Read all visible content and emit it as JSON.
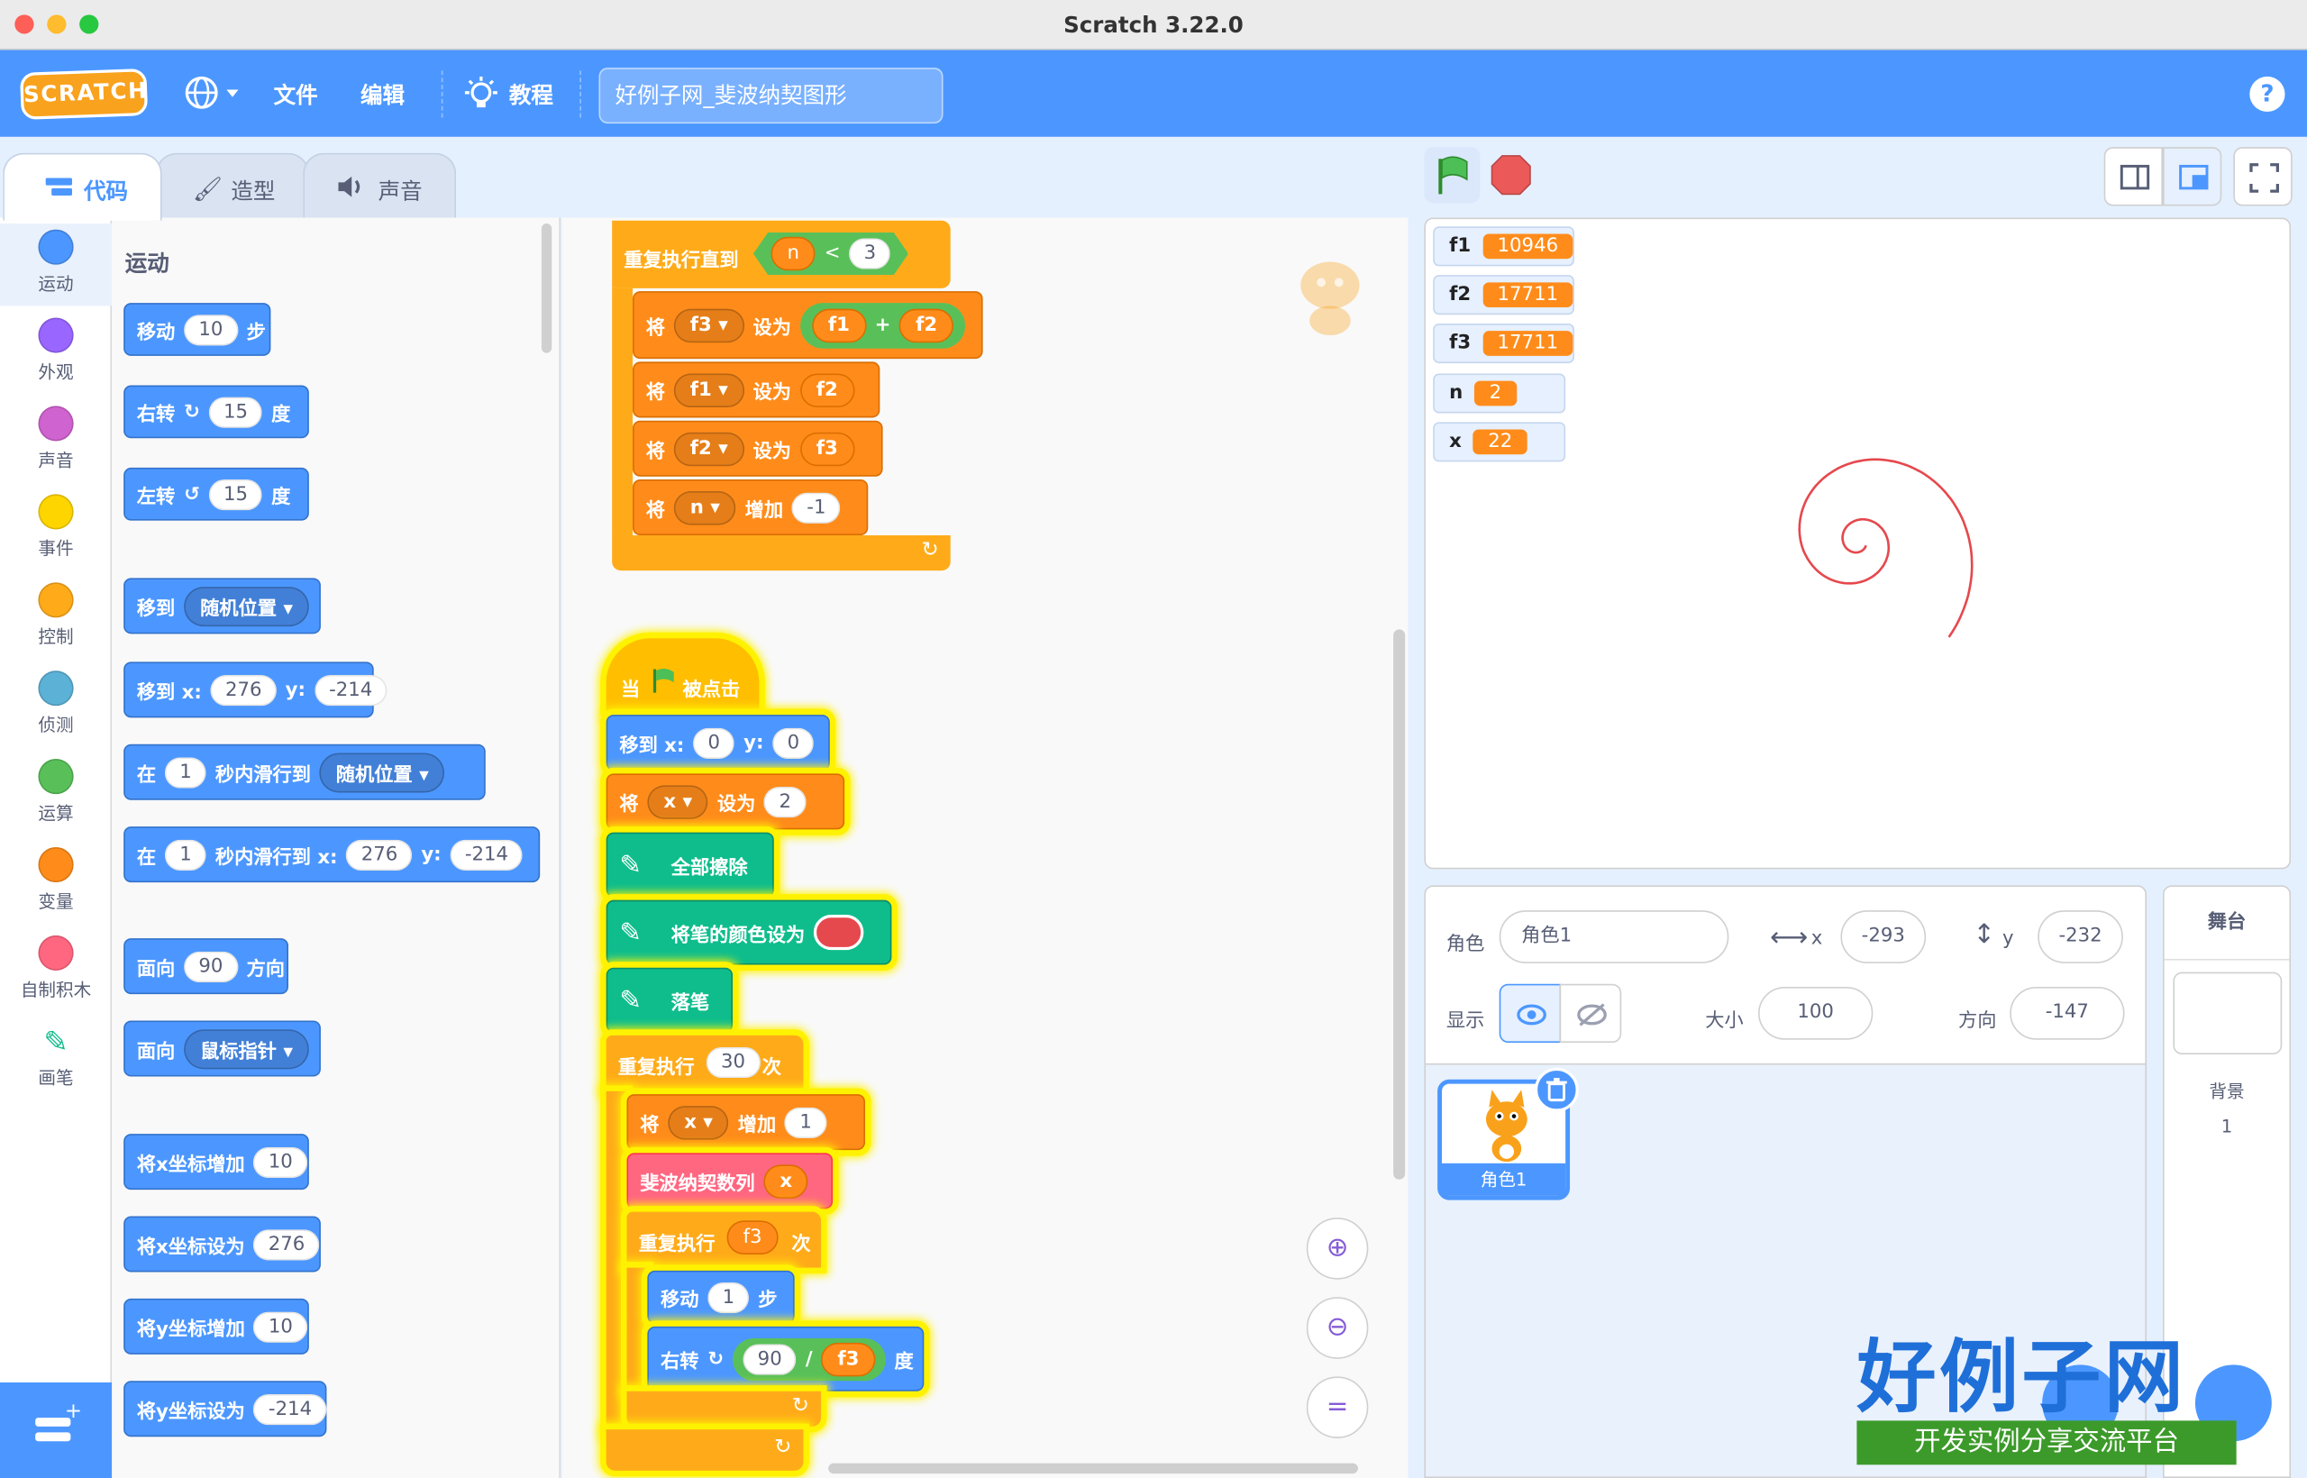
{
  "window": {
    "title": "Scratch 3.22.0"
  },
  "menubar": {
    "logo": "SCRATCH",
    "file": "文件",
    "edit": "编辑",
    "tutorials": "教程",
    "project_title": "好例子网_斐波纳契图形",
    "help": "?"
  },
  "tabs": {
    "code": "代码",
    "costumes": "造型",
    "sounds": "声音"
  },
  "categories": [
    {
      "label": "运动",
      "color": "#4c97ff"
    },
    {
      "label": "外观",
      "color": "#9966ff"
    },
    {
      "label": "声音",
      "color": "#cf63cf"
    },
    {
      "label": "事件",
      "color": "#ffd500"
    },
    {
      "label": "控制",
      "color": "#ffab19"
    },
    {
      "label": "侦测",
      "color": "#5cb1d6"
    },
    {
      "label": "运算",
      "color": "#59c059"
    },
    {
      "label": "变量",
      "color": "#ff8c1a"
    },
    {
      "label": "自制积木",
      "color": "#ff6680"
    },
    {
      "label": "画笔",
      "color": "#0fbd8c"
    }
  ],
  "palette": {
    "heading": "运动",
    "move": {
      "label": "移动",
      "steps": "10",
      "unit": "步"
    },
    "turn_right": {
      "label": "右转",
      "value": "15",
      "unit": "度"
    },
    "turn_left": {
      "label": "左转",
      "value": "15",
      "unit": "度"
    },
    "goto": {
      "label": "移到",
      "target": "随机位置"
    },
    "goto_xy": {
      "label": "移到 x:",
      "x": "276",
      "ylabel": "y:",
      "y": "-214"
    },
    "glide_to": {
      "pre": "在",
      "secs": "1",
      "mid": "秒内滑行到",
      "target": "随机位置"
    },
    "glide_xy": {
      "pre": "在",
      "secs": "1",
      "mid": "秒内滑行到 x:",
      "x": "276",
      "ylabel": "y:",
      "y": "-214"
    },
    "point_dir": {
      "label": "面向",
      "value": "90",
      "unit": "方向"
    },
    "point_towards": {
      "label": "面向",
      "target": "鼠标指针"
    },
    "change_x": {
      "label": "将x坐标增加",
      "value": "10"
    },
    "set_x": {
      "label": "将x坐标设为",
      "value": "276"
    },
    "change_y": {
      "label": "将y坐标增加",
      "value": "10"
    },
    "set_y": {
      "label": "将y坐标设为",
      "value": "-214"
    }
  },
  "script1": {
    "repeat_until": "重复执行直到",
    "cond": {
      "left": "n",
      "op": "<",
      "right": "3"
    },
    "set1": {
      "pre": "将",
      "var": "f3",
      "mid": "设为",
      "a": "f1",
      "op": "+",
      "b": "f2"
    },
    "set2": {
      "pre": "将",
      "var": "f1",
      "mid": "设为",
      "val": "f2"
    },
    "set3": {
      "pre": "将",
      "var": "f2",
      "mid": "设为",
      "val": "f3"
    },
    "change": {
      "pre": "将",
      "var": "n",
      "mid": "增加",
      "val": "-1"
    }
  },
  "script2": {
    "hat": {
      "pre": "当",
      "post": "被点击"
    },
    "goto": {
      "label": "移到 x:",
      "x": "0",
      "ylabel": "y:",
      "y": "0"
    },
    "setx": {
      "pre": "将",
      "var": "x",
      "mid": "设为",
      "val": "2"
    },
    "clear": "全部擦除",
    "pen_color": "将笔的颜色设为",
    "pen_color_value": "#e5484d",
    "pen_down": "落笔",
    "repeat": {
      "pre": "重复执行",
      "val": "30",
      "post": "次"
    },
    "change_x": {
      "pre": "将",
      "var": "x",
      "mid": "增加",
      "val": "1"
    },
    "fib": {
      "label": "斐波纳契数列",
      "arg": "x"
    },
    "repeat2": {
      "pre": "重复执行",
      "val": "f3",
      "post": "次"
    },
    "move": {
      "label": "移动",
      "val": "1",
      "unit": "步"
    },
    "turn": {
      "label": "右转",
      "a": "90",
      "op": "/",
      "b": "f3",
      "unit": "度"
    }
  },
  "monitors": [
    {
      "name": "f1",
      "value": "10946"
    },
    {
      "name": "f2",
      "value": "17711"
    },
    {
      "name": "f3",
      "value": "17711"
    },
    {
      "name": "n",
      "value": "2"
    },
    {
      "name": "x",
      "value": "22"
    }
  ],
  "sprite_info": {
    "sprite_label": "角色",
    "sprite_name": "角色1",
    "x_label": "x",
    "x": "-293",
    "y_label": "y",
    "y": "-232",
    "show_label": "显示",
    "size_label": "大小",
    "size": "100",
    "direction_label": "方向",
    "direction": "-147"
  },
  "sprite_list": [
    {
      "name": "角色1"
    }
  ],
  "stage_pane": {
    "title": "舞台",
    "backdrops_label": "背景",
    "backdrops_count": "1"
  },
  "watermark": {
    "big": "好例子网",
    "sub": "开发实例分享交流平台"
  },
  "colors": {
    "accent": "#4c97ff",
    "spiral": "#e5484d"
  }
}
